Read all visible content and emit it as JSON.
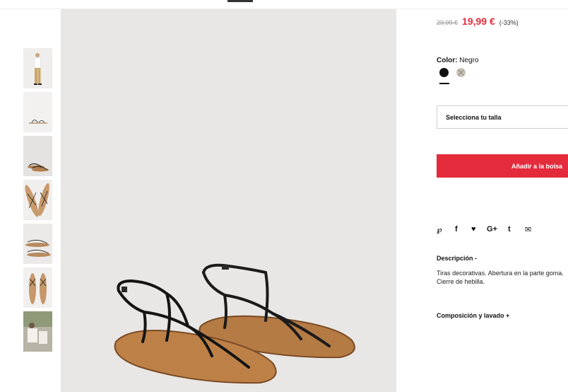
{
  "product": {
    "old_price": "29,99 €",
    "new_price": "19,99 €",
    "discount": "(-33%)",
    "color_label": "Color:",
    "color_value": "Negro",
    "colors": [
      {
        "name": "negro",
        "hex": "#111111"
      },
      {
        "name": "gris",
        "hex": "#c9c2b8"
      }
    ],
    "size_placeholder": "Selecciona tu talla",
    "add_to_bag": "Añadir a la bolsa"
  },
  "share": {
    "icons": [
      "pinterest-icon",
      "facebook-icon",
      "twitter-icon",
      "google-plus-icon",
      "tumblr-icon",
      "email-icon"
    ],
    "glyphs": [
      "℘",
      "f",
      "♥",
      "G+",
      "t",
      "✉"
    ]
  },
  "description": {
    "title": "Descripción -",
    "text": "Tiras decorativas. Abertura en la parte goma. Cierre de hebilla."
  },
  "composition": {
    "title": "Composición y lavado +"
  },
  "colors": {
    "accent": "#e42b3c",
    "price_red": "#e32c3c",
    "image_bg": "#e8e7e5"
  }
}
